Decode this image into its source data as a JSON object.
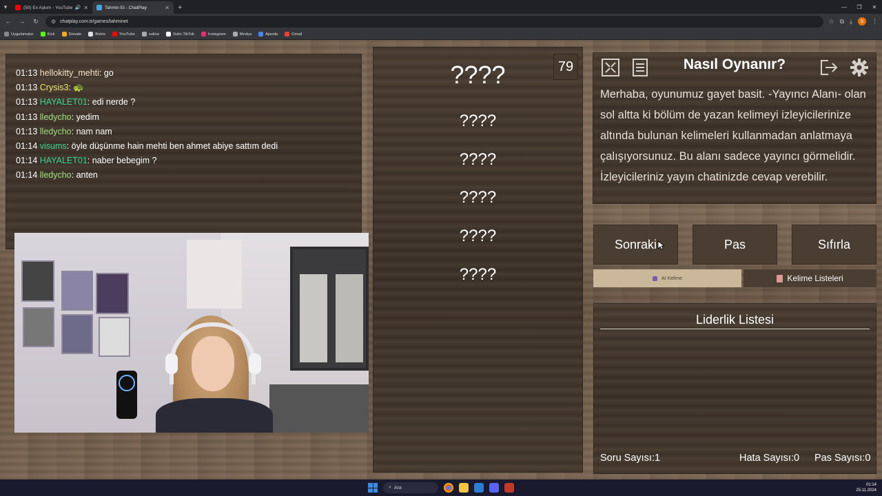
{
  "browser": {
    "tabs": [
      {
        "title": "(50) Ex Aşkım - YouTube",
        "color": "#ff0000",
        "active": false
      },
      {
        "title": "Tahmin Et - ChatPlay",
        "color": "#4aa3df",
        "active": true
      }
    ],
    "url": "chatplay.com.tr/games/tahminet",
    "profile_letter": "S",
    "bookmarks": [
      {
        "label": "Uygulamalar",
        "color": "#888"
      },
      {
        "label": "Kick",
        "color": "#53fc18"
      },
      {
        "label": "Donate",
        "color": "#f5a623"
      },
      {
        "label": "Botrix",
        "color": "#ddd"
      },
      {
        "label": "YouTube",
        "color": "#ff0000"
      },
      {
        "label": "sulina",
        "color": "#aaa"
      },
      {
        "label": "Sulin TikTok",
        "color": "#fff"
      },
      {
        "label": "Instagram",
        "color": "#e1306c"
      },
      {
        "label": "Medya",
        "color": "#aaa"
      },
      {
        "label": "Ajanda",
        "color": "#4285f4"
      },
      {
        "label": "Gmail",
        "color": "#ea4335"
      }
    ]
  },
  "chat": {
    "messages": [
      {
        "time": "01:13",
        "user": "hellokitty_mehti",
        "text": ": go",
        "color": "pink"
      },
      {
        "time": "01:13",
        "user": "Crysis3",
        "text": ": 🐢",
        "color": "yellow"
      },
      {
        "time": "01:13",
        "user": "HAYALET01",
        "text": ": edi nerde ?",
        "color": "green"
      },
      {
        "time": "01:13",
        "user": "lledycho",
        "text": ": yedim",
        "color": "lime"
      },
      {
        "time": "01:13",
        "user": "lledycho",
        "text": ": nam nam",
        "color": "lime"
      },
      {
        "time": "01:14",
        "user": "visums",
        "text": ": öyle düşünme hain mehti ben ahmet abiye sattım dedi",
        "color": "green"
      },
      {
        "time": "01:14",
        "user": "HAYALET01",
        "text": ": naber bebegim ?",
        "color": "green"
      },
      {
        "time": "01:14",
        "user": "lledycho",
        "text": ": anten",
        "color": "lime"
      }
    ]
  },
  "game": {
    "timer": "79",
    "main_word": "????",
    "forbidden_words": [
      "????",
      "????",
      "????",
      "????",
      "????"
    ]
  },
  "info": {
    "title": "Nasıl Oynanır?",
    "text": "Merhaba, oyunumuz gayet basit. -Yayıncı Alanı- olan sol altta ki bölüm de yazan kelimeyi izleyicilerinize altında bulunan kelimeleri kullanmadan anlatmaya çalışıyorsunuz. Bu alanı sadece yayıncı görmelidir. İzleyicileriniz yayın chatinizde cevap verebilir."
  },
  "actions": {
    "next": "Sonraki",
    "pass": "Pas",
    "reset": "Sıfırla",
    "ai_tab": "AI Kelime",
    "list_tab": "Kelime Listeleri"
  },
  "leaderboard": {
    "title": "Liderlik Listesi",
    "question_count": "Soru Sayısı:1",
    "error_count": "Hata Sayısı:0",
    "pass_count": "Pas Sayısı:0"
  },
  "taskbar": {
    "search_placeholder": "Ara",
    "time": "01:14",
    "date": "25.11.2024"
  },
  "colors": {
    "accent_green": "#39d48f",
    "panel": "#4a3d32",
    "ai_tab": "#cbb89a"
  }
}
